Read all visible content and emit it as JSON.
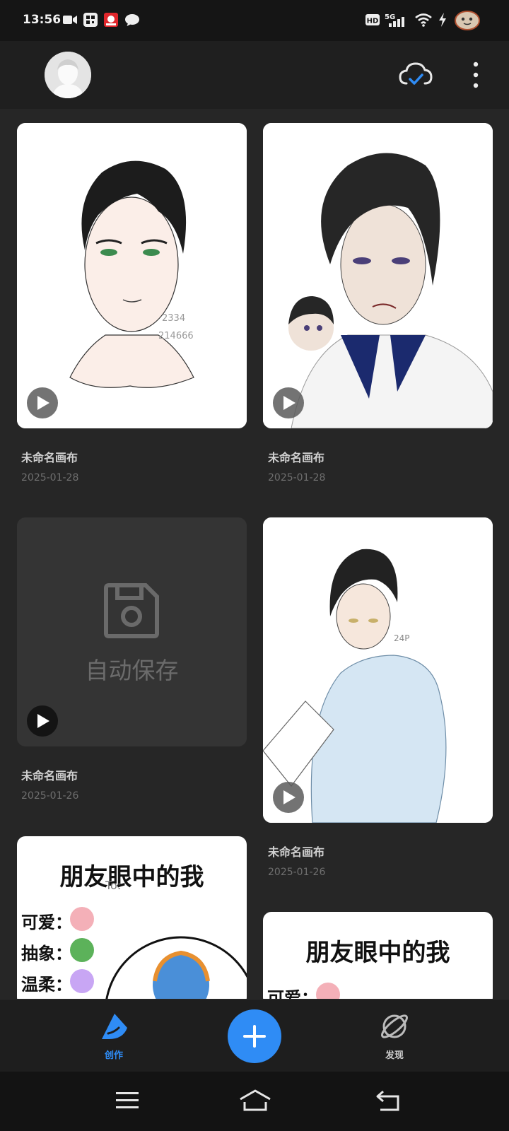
{
  "status_bar": {
    "time": "13:56",
    "left_icons": [
      "video-call-icon",
      "qr-app-icon",
      "red-app-icon",
      "chat-bubble-icon"
    ],
    "right_icons": [
      "hd-icon",
      "5g-signal-icon",
      "wifi-icon",
      "charging-icon",
      "battery-icon"
    ],
    "network_label": "5G",
    "hd_label": "HD"
  },
  "header": {
    "avatar_icon": "user-avatar-icon",
    "cloud_icon": "cloud-sync-check-icon",
    "more_icon": "more-vertical-icon",
    "accent_color": "#2f8cf5"
  },
  "artworks": [
    {
      "title": "未命名画布",
      "date": "2025-01-28",
      "thumbnail": "portrait-sketch-green-eyes"
    },
    {
      "title": "未命名画布",
      "date": "2025-01-28",
      "thumbnail": "school-uniform-boy"
    },
    {
      "title": "未命名画布",
      "date": "2025-01-26",
      "thumbnail": "autosave-placeholder",
      "placeholder_label": "自动保存"
    },
    {
      "title": "未命名画布",
      "date": "2025-01-26",
      "thumbnail": "boy-light-blue-hoodie"
    },
    {
      "title": "",
      "date": "",
      "thumbnail": "friends-eyes-poster",
      "poster_title": "朋友眼中的我",
      "poster_labels": [
        "可爱：",
        "抽象：",
        "温柔："
      ]
    },
    {
      "title": "",
      "date": "",
      "thumbnail": "friends-eyes-poster",
      "poster_title": "朋友眼中的我",
      "poster_labels": [
        "可爱："
      ]
    }
  ],
  "bottom_nav": {
    "create_label": "创作",
    "discover_label": "发现",
    "add_icon": "plus-icon",
    "create_icon": "brush-create-icon",
    "discover_icon": "planet-icon",
    "active_color": "#2f8cf5"
  },
  "system_nav": {
    "icons": [
      "menu-icon",
      "home-icon",
      "back-icon"
    ]
  }
}
